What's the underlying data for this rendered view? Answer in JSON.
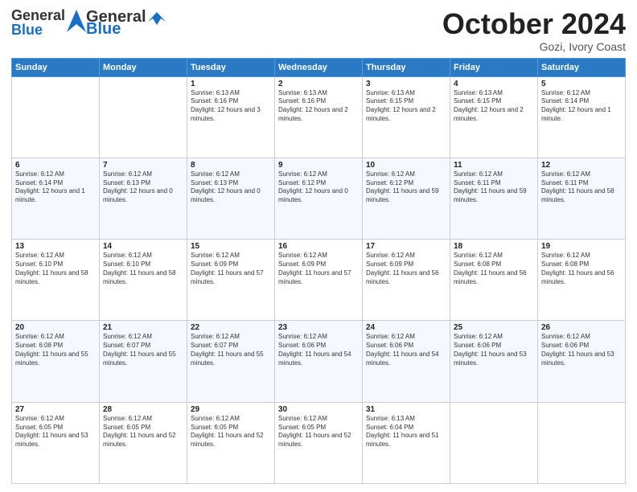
{
  "header": {
    "logo_general": "General",
    "logo_blue": "Blue",
    "month_title": "October 2024",
    "location": "Gozi, Ivory Coast"
  },
  "days_of_week": [
    "Sunday",
    "Monday",
    "Tuesday",
    "Wednesday",
    "Thursday",
    "Friday",
    "Saturday"
  ],
  "weeks": [
    [
      {
        "day": "",
        "info": ""
      },
      {
        "day": "",
        "info": ""
      },
      {
        "day": "1",
        "info": "Sunrise: 6:13 AM\nSunset: 6:16 PM\nDaylight: 12 hours and 3 minutes."
      },
      {
        "day": "2",
        "info": "Sunrise: 6:13 AM\nSunset: 6:16 PM\nDaylight: 12 hours and 2 minutes."
      },
      {
        "day": "3",
        "info": "Sunrise: 6:13 AM\nSunset: 6:15 PM\nDaylight: 12 hours and 2 minutes."
      },
      {
        "day": "4",
        "info": "Sunrise: 6:13 AM\nSunset: 6:15 PM\nDaylight: 12 hours and 2 minutes."
      },
      {
        "day": "5",
        "info": "Sunrise: 6:12 AM\nSunset: 6:14 PM\nDaylight: 12 hours and 1 minute."
      }
    ],
    [
      {
        "day": "6",
        "info": "Sunrise: 6:12 AM\nSunset: 6:14 PM\nDaylight: 12 hours and 1 minute."
      },
      {
        "day": "7",
        "info": "Sunrise: 6:12 AM\nSunset: 6:13 PM\nDaylight: 12 hours and 0 minutes."
      },
      {
        "day": "8",
        "info": "Sunrise: 6:12 AM\nSunset: 6:13 PM\nDaylight: 12 hours and 0 minutes."
      },
      {
        "day": "9",
        "info": "Sunrise: 6:12 AM\nSunset: 6:12 PM\nDaylight: 12 hours and 0 minutes."
      },
      {
        "day": "10",
        "info": "Sunrise: 6:12 AM\nSunset: 6:12 PM\nDaylight: 11 hours and 59 minutes."
      },
      {
        "day": "11",
        "info": "Sunrise: 6:12 AM\nSunset: 6:11 PM\nDaylight: 11 hours and 59 minutes."
      },
      {
        "day": "12",
        "info": "Sunrise: 6:12 AM\nSunset: 6:11 PM\nDaylight: 11 hours and 58 minutes."
      }
    ],
    [
      {
        "day": "13",
        "info": "Sunrise: 6:12 AM\nSunset: 6:10 PM\nDaylight: 11 hours and 58 minutes."
      },
      {
        "day": "14",
        "info": "Sunrise: 6:12 AM\nSunset: 6:10 PM\nDaylight: 11 hours and 58 minutes."
      },
      {
        "day": "15",
        "info": "Sunrise: 6:12 AM\nSunset: 6:09 PM\nDaylight: 11 hours and 57 minutes."
      },
      {
        "day": "16",
        "info": "Sunrise: 6:12 AM\nSunset: 6:09 PM\nDaylight: 11 hours and 57 minutes."
      },
      {
        "day": "17",
        "info": "Sunrise: 6:12 AM\nSunset: 6:09 PM\nDaylight: 11 hours and 56 minutes."
      },
      {
        "day": "18",
        "info": "Sunrise: 6:12 AM\nSunset: 6:08 PM\nDaylight: 11 hours and 56 minutes."
      },
      {
        "day": "19",
        "info": "Sunrise: 6:12 AM\nSunset: 6:08 PM\nDaylight: 11 hours and 56 minutes."
      }
    ],
    [
      {
        "day": "20",
        "info": "Sunrise: 6:12 AM\nSunset: 6:08 PM\nDaylight: 11 hours and 55 minutes."
      },
      {
        "day": "21",
        "info": "Sunrise: 6:12 AM\nSunset: 6:07 PM\nDaylight: 11 hours and 55 minutes."
      },
      {
        "day": "22",
        "info": "Sunrise: 6:12 AM\nSunset: 6:07 PM\nDaylight: 11 hours and 55 minutes."
      },
      {
        "day": "23",
        "info": "Sunrise: 6:12 AM\nSunset: 6:06 PM\nDaylight: 11 hours and 54 minutes."
      },
      {
        "day": "24",
        "info": "Sunrise: 6:12 AM\nSunset: 6:06 PM\nDaylight: 11 hours and 54 minutes."
      },
      {
        "day": "25",
        "info": "Sunrise: 6:12 AM\nSunset: 6:06 PM\nDaylight: 11 hours and 53 minutes."
      },
      {
        "day": "26",
        "info": "Sunrise: 6:12 AM\nSunset: 6:06 PM\nDaylight: 11 hours and 53 minutes."
      }
    ],
    [
      {
        "day": "27",
        "info": "Sunrise: 6:12 AM\nSunset: 6:05 PM\nDaylight: 11 hours and 53 minutes."
      },
      {
        "day": "28",
        "info": "Sunrise: 6:12 AM\nSunset: 6:05 PM\nDaylight: 11 hours and 52 minutes."
      },
      {
        "day": "29",
        "info": "Sunrise: 6:12 AM\nSunset: 6:05 PM\nDaylight: 11 hours and 52 minutes."
      },
      {
        "day": "30",
        "info": "Sunrise: 6:12 AM\nSunset: 6:05 PM\nDaylight: 11 hours and 52 minutes."
      },
      {
        "day": "31",
        "info": "Sunrise: 6:13 AM\nSunset: 6:04 PM\nDaylight: 11 hours and 51 minutes."
      },
      {
        "day": "",
        "info": ""
      },
      {
        "day": "",
        "info": ""
      }
    ]
  ]
}
